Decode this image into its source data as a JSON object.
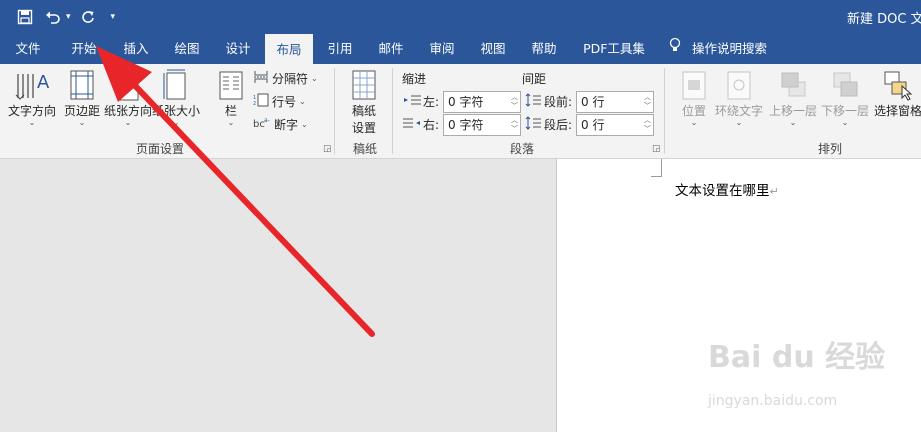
{
  "titlebar": {
    "doc_title": "新建 DOC 文",
    "colors": {
      "brand": "#2b579a"
    },
    "qat": [
      "save-icon",
      "undo-icon",
      "redo-icon",
      "customize-icon"
    ]
  },
  "tabs": [
    {
      "label": "文件"
    },
    {
      "label": "开始"
    },
    {
      "label": "插入"
    },
    {
      "label": "绘图"
    },
    {
      "label": "设计"
    },
    {
      "label": "布局"
    },
    {
      "label": "引用"
    },
    {
      "label": "邮件"
    },
    {
      "label": "审阅"
    },
    {
      "label": "视图"
    },
    {
      "label": "帮助"
    },
    {
      "label": "PDF工具集"
    }
  ],
  "active_tab": "布局",
  "tell_me": "操作说明搜索",
  "ribbon": {
    "page_setup": {
      "label": "页面设置",
      "text_direction": "文字方向",
      "margins": "页边距",
      "orientation": "纸张方向",
      "size": "纸张大小",
      "columns": "栏",
      "breaks": "分隔符",
      "line_numbers": "行号",
      "hyphenation": "断字"
    },
    "manuscript": {
      "label": "稿纸",
      "btn_line1": "稿纸",
      "btn_line2": "设置"
    },
    "paragraph": {
      "label": "段落",
      "indent_heading": "缩进",
      "spacing_heading": "间距",
      "left_label": "左:",
      "right_label": "右:",
      "before_label": "段前:",
      "after_label": "段后:",
      "left_value": "0 字符",
      "right_value": "0 字符",
      "before_value": "0 行",
      "after_value": "0 行"
    },
    "arrange": {
      "label": "排列",
      "position": "位置",
      "wrap_text": "环绕文字",
      "bring_forward": "上移一层",
      "send_backward": "下移一层",
      "selection_pane": "选择窗格"
    }
  },
  "document": {
    "text": "文本设置在哪里",
    "paragraph_mark": "↵"
  },
  "watermark": {
    "logo": "Bai du 经验",
    "url": "jingyan.baidu.com"
  },
  "annotation": {
    "type": "red-arrow",
    "color": "#e8262a",
    "points_to": "开始"
  }
}
